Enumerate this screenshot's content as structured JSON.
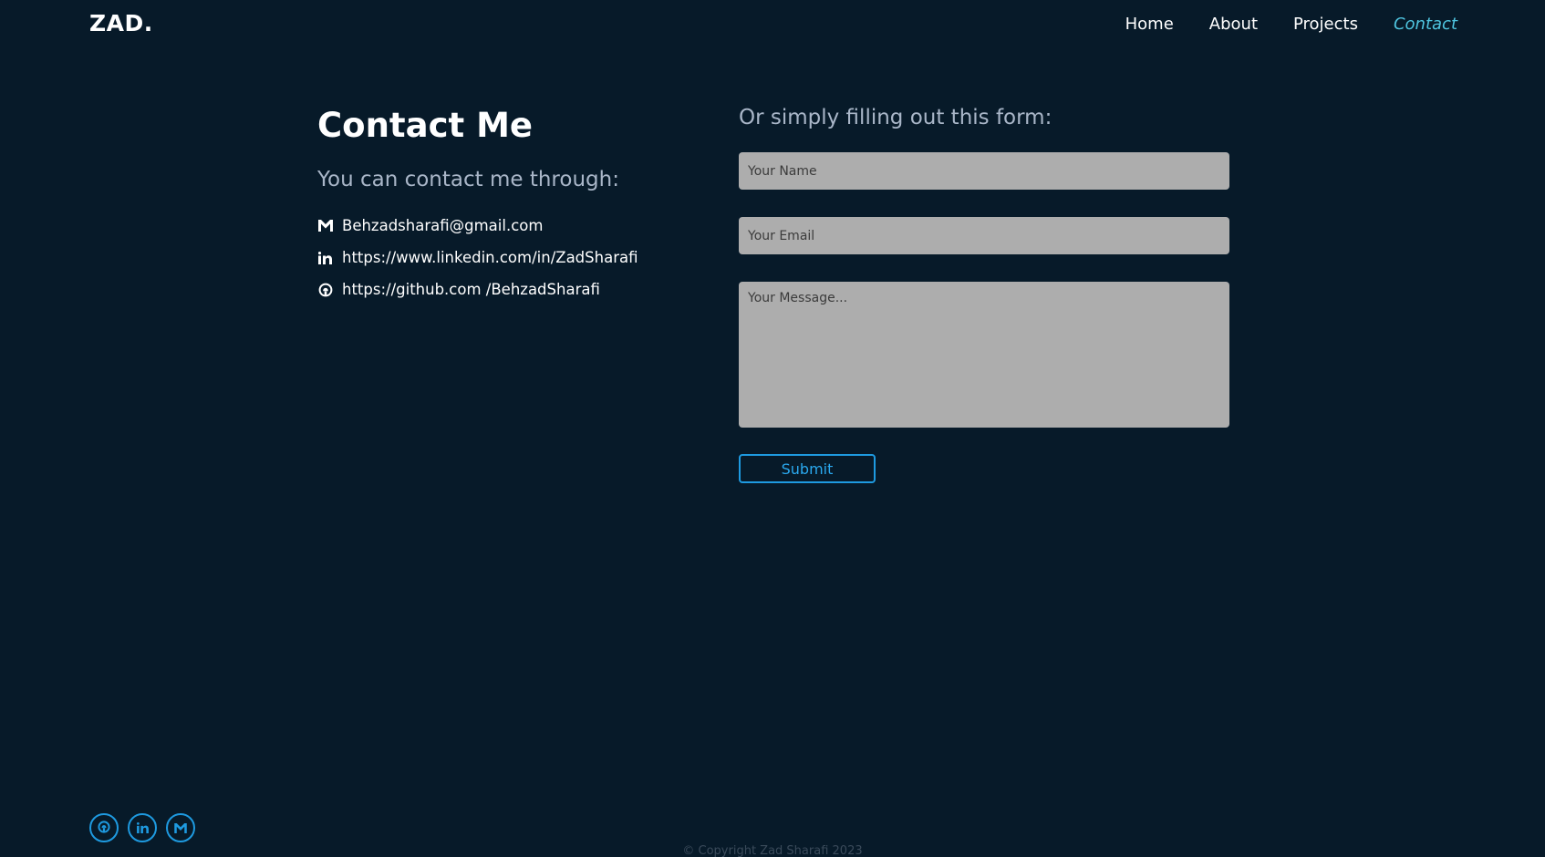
{
  "header": {
    "logo": "ZAD.",
    "nav": [
      {
        "label": "Home"
      },
      {
        "label": "About"
      },
      {
        "label": "Projects"
      },
      {
        "label": "Contact"
      }
    ],
    "active_nav": "Contact"
  },
  "contact": {
    "title": "Contact Me",
    "subtitle": "You can contact me through:",
    "items": [
      {
        "icon": "gmail-icon",
        "text": "Behzadsharafi@gmail.com"
      },
      {
        "icon": "linkedin-icon",
        "text": "https://www.linkedin.com/in/ZadSharafi"
      },
      {
        "icon": "github-icon",
        "text": "https://github.com /BehzadSharafi"
      }
    ]
  },
  "form": {
    "heading": "Or simply filling out this form:",
    "name_placeholder": "Your Name",
    "email_placeholder": "Your Email",
    "message_placeholder": "Your Message...",
    "submit_label": "Submit"
  },
  "footer": {
    "socials": [
      "github-icon",
      "linkedin-icon",
      "gmail-icon"
    ],
    "copyright": "© Copyright Zad Sharafi 2023"
  },
  "colors": {
    "background": "#071a29",
    "accent": "#1e9ae0",
    "active_nav": "#4fc5e0",
    "muted_text": "#a9b6c8",
    "field_bg": "#adadad"
  }
}
